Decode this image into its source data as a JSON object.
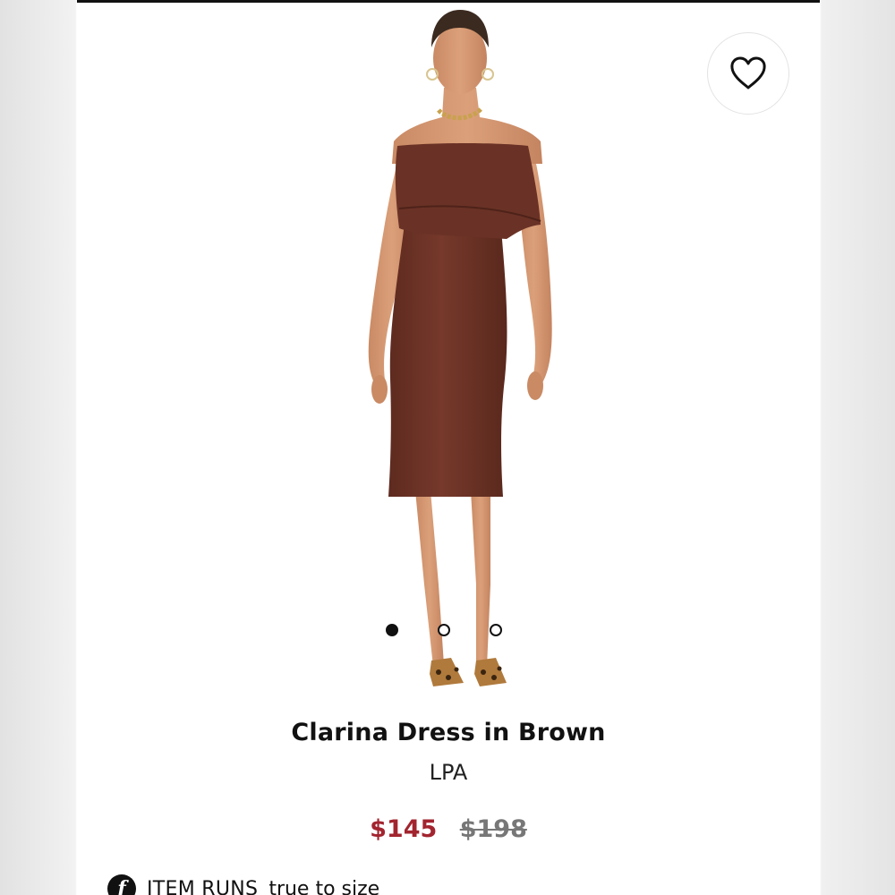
{
  "product": {
    "title": "Clarina Dress in Brown",
    "brand": "LPA",
    "price_sale": "$145",
    "price_original": "$198",
    "image_alt": "Model wearing brown off-shoulder midi dress"
  },
  "carousel": {
    "total_slides": 3,
    "active_index": 0
  },
  "fit": {
    "icon_letter": "f",
    "label": "ITEM RUNS",
    "value": "true to size"
  },
  "colors": {
    "dress": "#6e3427",
    "sale_price": "#a2242f"
  },
  "icons": {
    "wishlist": "heart-icon",
    "fit": "fit-badge-icon"
  }
}
